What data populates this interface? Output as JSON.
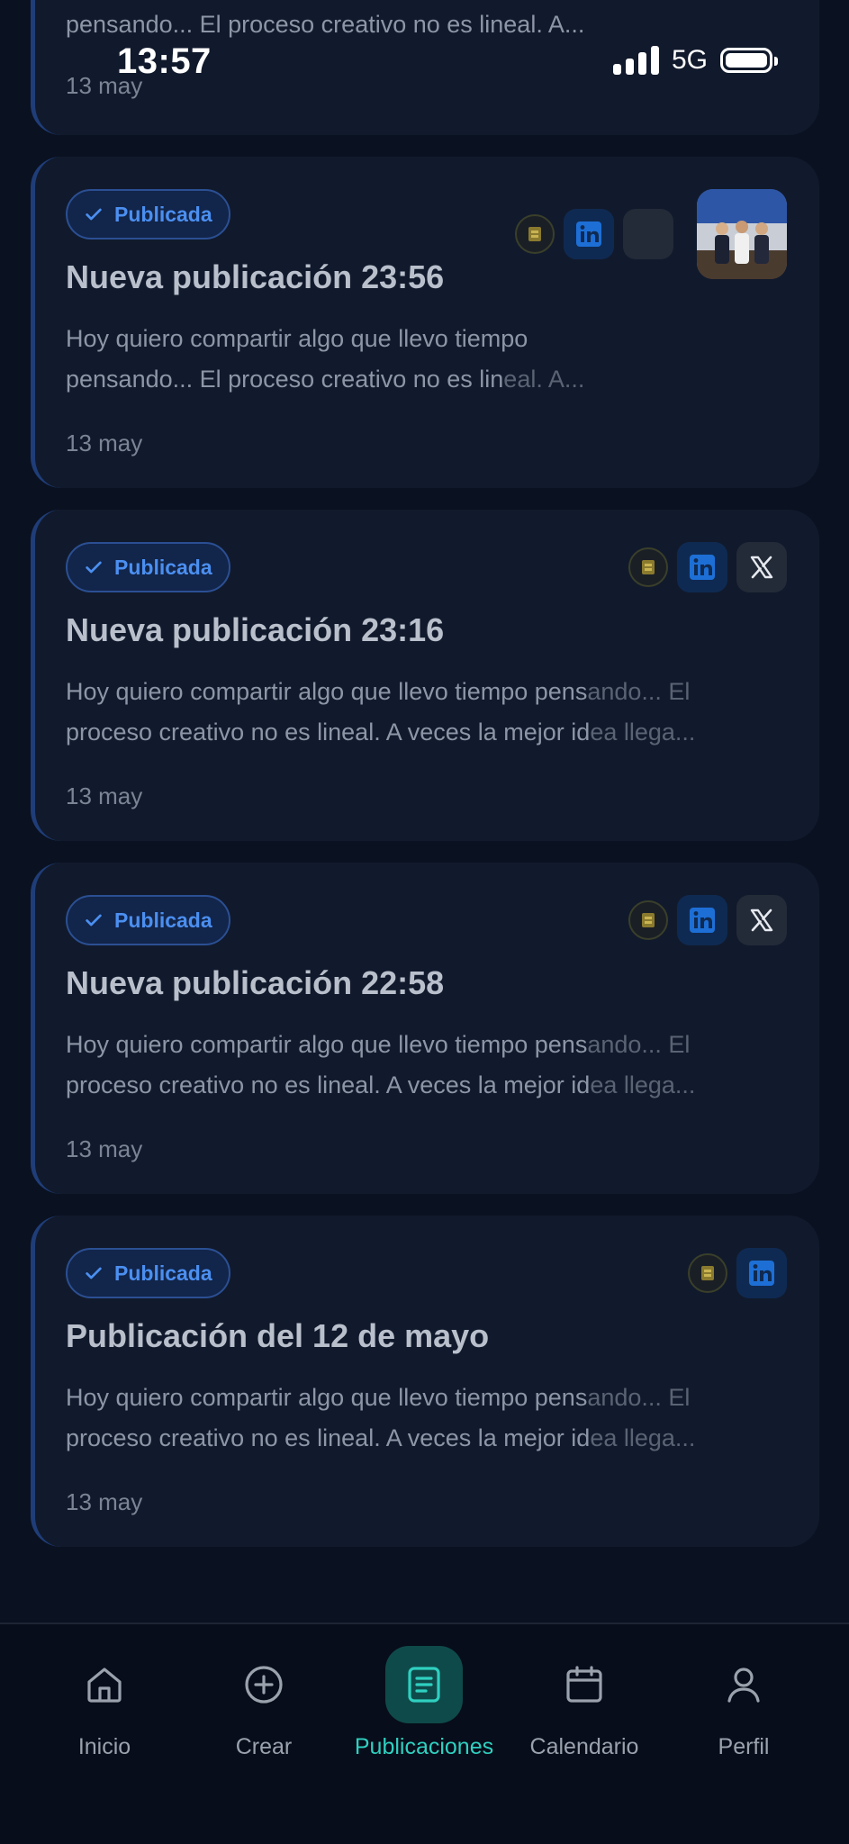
{
  "status_bar": {
    "time": "13:57",
    "network": "5G"
  },
  "top_partial_card": {
    "excerpt_line": "pensando... El proceso creativo no es lineal. A...",
    "date": "13 may"
  },
  "posts": [
    {
      "status": "Publicada",
      "title": "Nueva publicación 23:56",
      "excerpt_a": "Hoy quiero compartir algo que llevo tiempo",
      "excerpt_b": "pensando... El proceso creativo no es lin",
      "excerpt_b_fade": "eal. A...",
      "date": "13 may",
      "networks": [
        "brand-logo",
        "linkedin",
        "empty"
      ],
      "has_thumbnail": true
    },
    {
      "status": "Publicada",
      "title": "Nueva publicación 23:16",
      "excerpt_a": "Hoy quiero compartir algo que llevo tiempo pens",
      "excerpt_a_fade": "ando... El",
      "excerpt_b": "proceso creativo no es lineal. A veces la mejor id",
      "excerpt_b_fade": "ea llega...",
      "date": "13 may",
      "networks": [
        "brand-logo",
        "linkedin",
        "x"
      ]
    },
    {
      "status": "Publicada",
      "title": "Nueva publicación 22:58",
      "excerpt_a": "Hoy quiero compartir algo que llevo tiempo pens",
      "excerpt_a_fade": "ando... El",
      "excerpt_b": "proceso creativo no es lineal. A veces la mejor id",
      "excerpt_b_fade": "ea llega...",
      "date": "13 may",
      "networks": [
        "brand-logo",
        "linkedin",
        "x"
      ]
    },
    {
      "status": "Publicada",
      "title": "Publicación del 12 de mayo",
      "excerpt_a": "Hoy quiero compartir algo que llevo tiempo pens",
      "excerpt_a_fade": "ando... El",
      "excerpt_b": "proceso creativo no es lineal. A veces la mejor id",
      "excerpt_b_fade": "ea llega...",
      "date": "13 may",
      "networks": [
        "brand-logo",
        "linkedin"
      ]
    }
  ],
  "nav": {
    "items": [
      {
        "label": "Inicio",
        "icon": "home-icon"
      },
      {
        "label": "Crear",
        "icon": "plus-circle-icon"
      },
      {
        "label": "Publicaciones",
        "icon": "document-icon",
        "active": true
      },
      {
        "label": "Calendario",
        "icon": "calendar-icon"
      },
      {
        "label": "Perfil",
        "icon": "user-icon"
      }
    ]
  },
  "colors": {
    "background": "#0a1120",
    "card": "#111a2c",
    "badge_text": "#4b8ff0",
    "accent_active": "#2fd0c0",
    "linkedin": "#1d6fd6"
  }
}
